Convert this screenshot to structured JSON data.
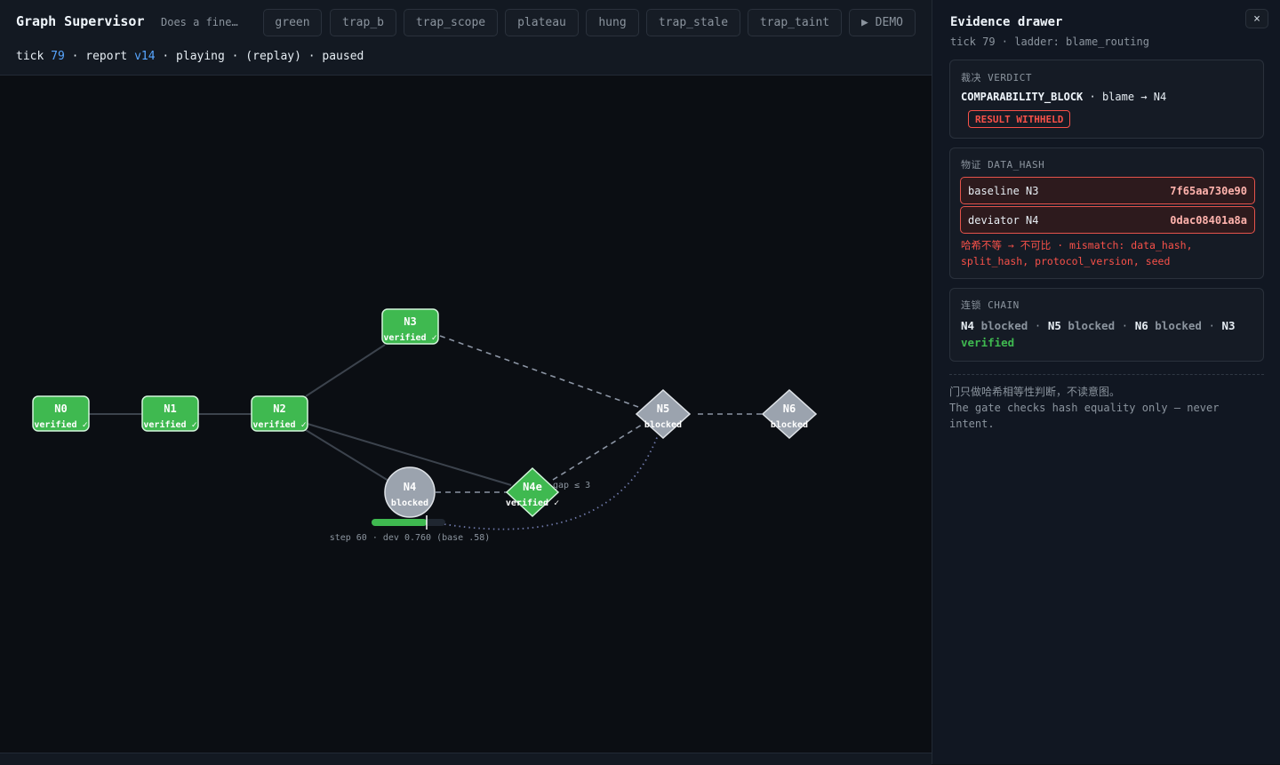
{
  "header": {
    "title": "Graph Supervisor",
    "description": "Does a fine…",
    "scenarios": [
      "green",
      "trap_b",
      "trap_scope",
      "plateau",
      "hung",
      "trap_stale",
      "trap_taint",
      "▶ DEMO"
    ]
  },
  "status": {
    "tick_label": "tick ",
    "tick": "79",
    "report_label": " · report ",
    "report": "v14",
    "rest": " · playing · (replay) · paused"
  },
  "graph": {
    "nodes": [
      {
        "id": "N0",
        "state": "verified ✓"
      },
      {
        "id": "N1",
        "state": "verified ✓"
      },
      {
        "id": "N2",
        "state": "verified ✓"
      },
      {
        "id": "N3",
        "state": "verified ✓"
      },
      {
        "id": "N4",
        "state": "blocked"
      },
      {
        "id": "N4e",
        "state": "verified ✓"
      },
      {
        "id": "N5",
        "state": "blocked"
      },
      {
        "id": "N6",
        "state": "blocked"
      }
    ],
    "edge_label": "gap ≤ 3",
    "progress_label": "step 60 · dev 0.760 (base .58)",
    "progress_fraction": 0.75,
    "colors": {
      "verified": "#3fb950",
      "blocked": "#9ba3ae",
      "edge": "#3c434d",
      "dashed": "#8b94a3",
      "dotted": "#6e78a8"
    }
  },
  "drawer": {
    "title": "Evidence drawer",
    "subtitle": "tick 79 · ladder: blame_routing",
    "close": "×",
    "verdict": {
      "label": "裁决 VERDICT",
      "code": "COMPARABILITY_BLOCK",
      "blame": " · blame → N4",
      "badge": "RESULT WITHHELD"
    },
    "data_hash": {
      "label": "物证 DATA_HASH",
      "rows": [
        {
          "key": "baseline N3",
          "value": "7f65aa730e90"
        },
        {
          "key": "deviator N4",
          "value": "0dac08401a8a"
        }
      ],
      "mismatch": "哈希不等 → 不可比 · mismatch: data_hash, split_hash, protocol_version, seed"
    },
    "chain": {
      "label": "连锁 CHAIN",
      "items": [
        {
          "node": "N4",
          "state": "blocked"
        },
        {
          "node": "N5",
          "state": "blocked"
        },
        {
          "node": "N6",
          "state": "blocked"
        },
        {
          "node": "N3",
          "state": "verified"
        }
      ],
      "sep": " · "
    },
    "note_zh": "门只做哈希相等性判断，不读意图。",
    "note_en": "The gate checks hash equality only — never intent."
  }
}
